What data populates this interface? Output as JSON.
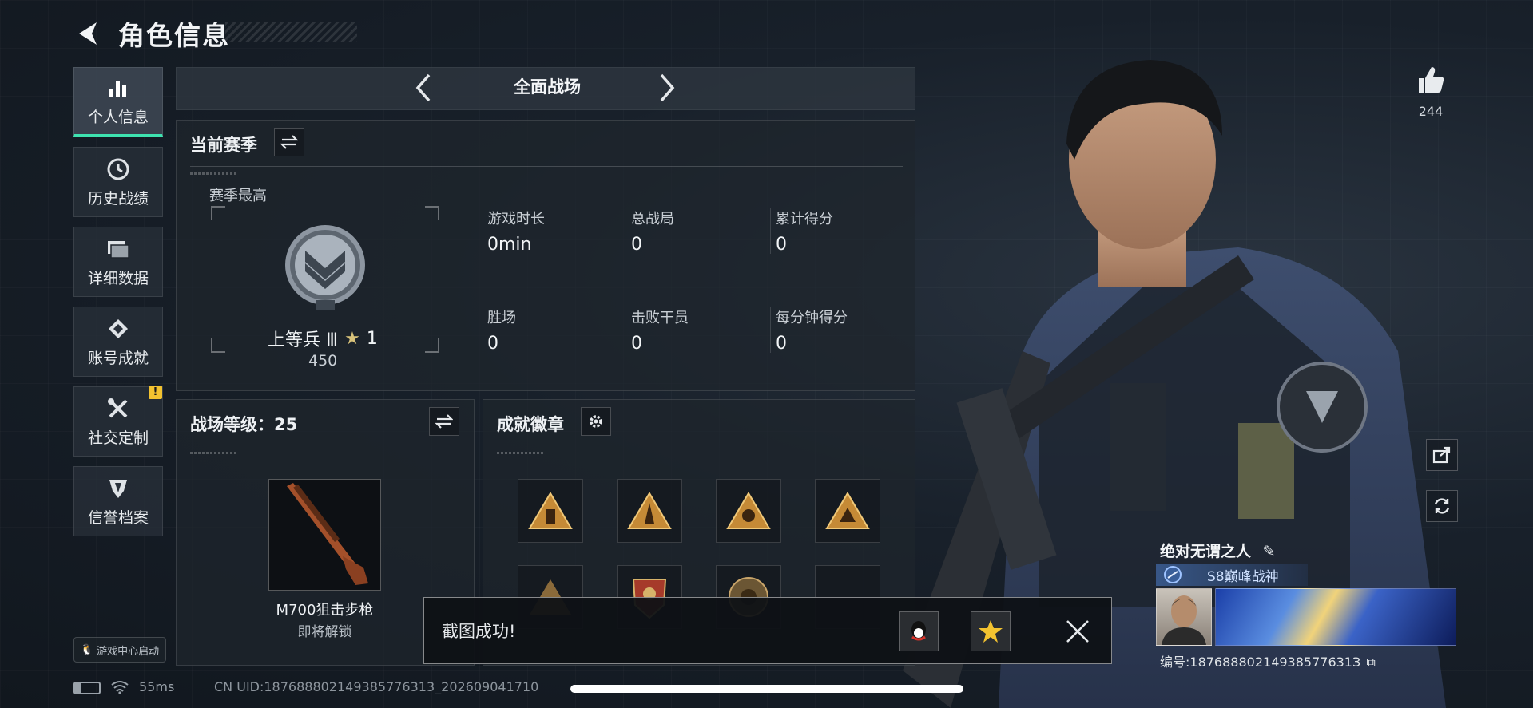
{
  "header": {
    "title": "角色信息"
  },
  "sidebar": {
    "items": [
      {
        "label": "个人信息",
        "icon": "bar-chart-icon",
        "active": true
      },
      {
        "label": "历史战绩",
        "icon": "clock-icon"
      },
      {
        "label": "详细数据",
        "icon": "folder-icon"
      },
      {
        "label": "账号成就",
        "icon": "achievement-icon"
      },
      {
        "label": "社交定制",
        "icon": "tools-icon",
        "badge": "!"
      },
      {
        "label": "信誉档案",
        "icon": "shield-icon"
      }
    ],
    "game_center": "游戏中心启动"
  },
  "mode": {
    "title": "全面战场"
  },
  "season": {
    "title": "当前赛季",
    "best_label": "赛季最高",
    "rank_name": "上等兵 Ⅲ",
    "stars": "1",
    "points": "450",
    "stats": [
      {
        "label": "游戏时长",
        "value": "0min"
      },
      {
        "label": "总战局",
        "value": "0"
      },
      {
        "label": "累计得分",
        "value": "0"
      },
      {
        "label": "胜场",
        "value": "0"
      },
      {
        "label": "击败干员",
        "value": "0"
      },
      {
        "label": "每分钟得分",
        "value": "0"
      }
    ]
  },
  "battlefield": {
    "level_label": "战场等级：25",
    "weapon_name": "M700狙击步枪",
    "weapon_status": "即将解锁"
  },
  "badges": {
    "title": "成就徽章"
  },
  "toast": {
    "text": "截图成功!"
  },
  "profile": {
    "likes": "244",
    "name": "绝对无谓之人",
    "title": "S8巅峰战神",
    "id_label": "编号:18768880214938577631З"
  },
  "status": {
    "ping": "55ms",
    "uid": "CN UID:187688802149385776313_202609041710"
  },
  "colors": {
    "accent": "#3ee3b0",
    "warning": "#f2c230",
    "badge_gold": "#d9a441"
  }
}
